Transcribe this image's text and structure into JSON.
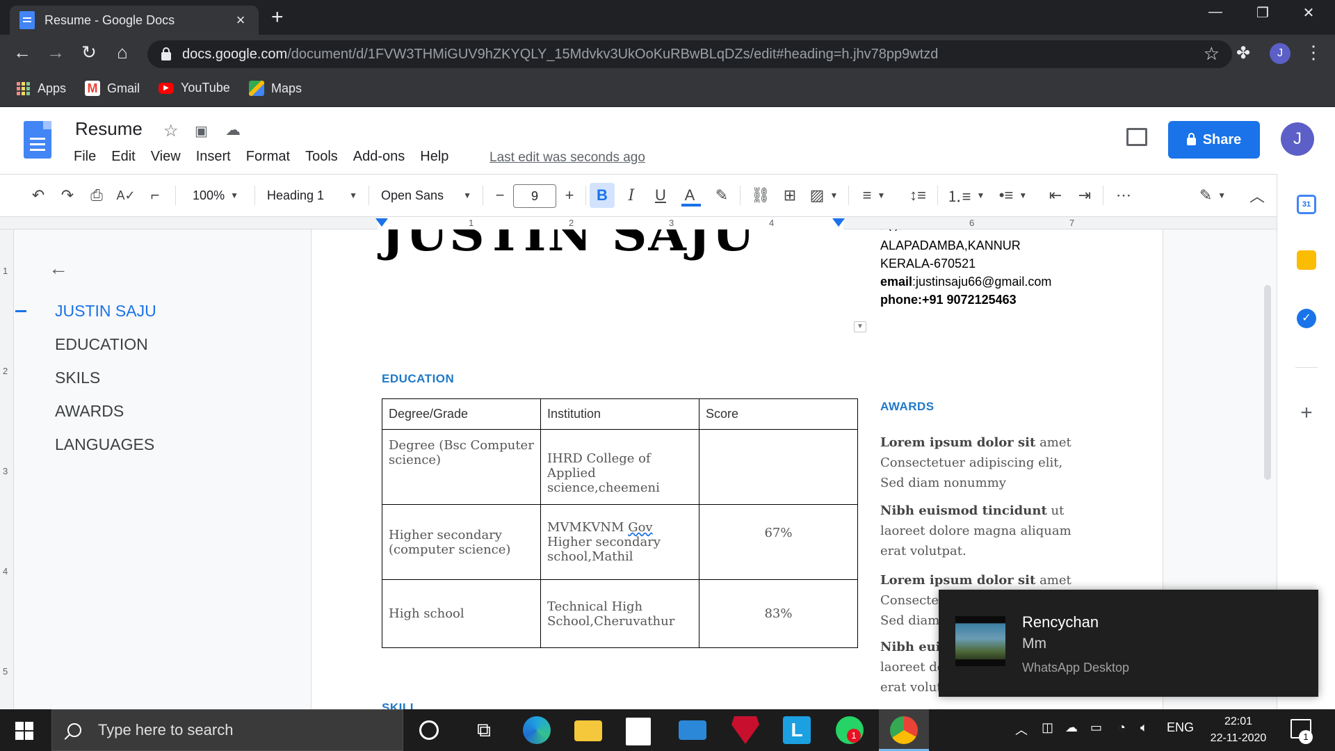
{
  "browser": {
    "tab_title": "Resume - Google Docs",
    "url_host": "docs.google.com",
    "url_path": "/document/d/1FVW3THMiGUV9hZKYQLY_15Mdvkv3UkOoKuRBwBLqDZs/edit#heading=h.jhv78pp9wtzd",
    "profile_initial": "J",
    "bookmarks": [
      "Apps",
      "Gmail",
      "YouTube",
      "Maps"
    ]
  },
  "docs": {
    "title": "Resume",
    "menu": [
      "File",
      "Edit",
      "View",
      "Insert",
      "Format",
      "Tools",
      "Add-ons",
      "Help"
    ],
    "last_edit": "Last edit was seconds ago",
    "share_label": "Share",
    "user_initial": "J"
  },
  "toolbar": {
    "zoom": "100%",
    "style": "Heading 1",
    "font": "Open Sans",
    "font_size": "9"
  },
  "ruler": {
    "h_numbers": [
      "1",
      "2",
      "3",
      "4",
      "6",
      "7"
    ],
    "v_numbers": [
      "1",
      "2",
      "3",
      "4",
      "5"
    ]
  },
  "outline": {
    "items": [
      "JUSTIN SAJU",
      "EDUCATION",
      "SKILS",
      "AWARDS",
      "LANGUAGES"
    ],
    "active_index": 0
  },
  "document": {
    "name": "JUSTIN SAJU",
    "contact": {
      "line_cut": ",          (  ),",
      "line1": "ALAPADAMBA,KANNUR",
      "line2": "KERALA-670521",
      "email_label": "email",
      "email": ":justinsaju66@gmail.com",
      "phone": "phone:+91 9072125463"
    },
    "education_heading": "EDUCATION",
    "education_table": {
      "headers": [
        "Degree/Grade",
        "Institution",
        "Score"
      ],
      "rows": [
        {
          "degree": "Degree (Bsc Computer science)",
          "institution": "IHRD College of Applied science,cheemeni",
          "score": ""
        },
        {
          "degree": "Higher secondary (computer science)",
          "institution_a": "MVMKVNM ",
          "institution_b": "Gov",
          "institution_c": " Higher secondary school,Mathil",
          "score": "67%"
        },
        {
          "degree": "High school",
          "institution": "Technical High School,Cheruvathur",
          "score": "83%"
        }
      ]
    },
    "awards_heading": "AWARDS",
    "awards": [
      {
        "bold": "Lorem ipsum dolor sit",
        "rest": " amet Consectetuer adipiscing elit, Sed diam nonummy"
      },
      {
        "bold": "Nibh euismod tincidunt",
        "rest": " ut laoreet dolore magna aliquam erat volutpat."
      },
      {
        "bold": "Lorem ipsum dolor sit",
        "rest": " amet Consectetuer adipiscing elit, Sed diam nonummy"
      },
      {
        "bold": "Nibh euismod tincidunt",
        "rest": " ut laoreet dolore magna aliquam erat volutpat."
      }
    ],
    "skills_cut": "SKILL"
  },
  "notification": {
    "sender": "Rencychan",
    "message": "Mm",
    "app": "WhatsApp Desktop"
  },
  "taskbar": {
    "search_placeholder": "Type here to search",
    "language": "ENG",
    "time": "22:01",
    "date": "22-11-2020",
    "whatsapp_badge": "1",
    "notification_badge": "1"
  }
}
